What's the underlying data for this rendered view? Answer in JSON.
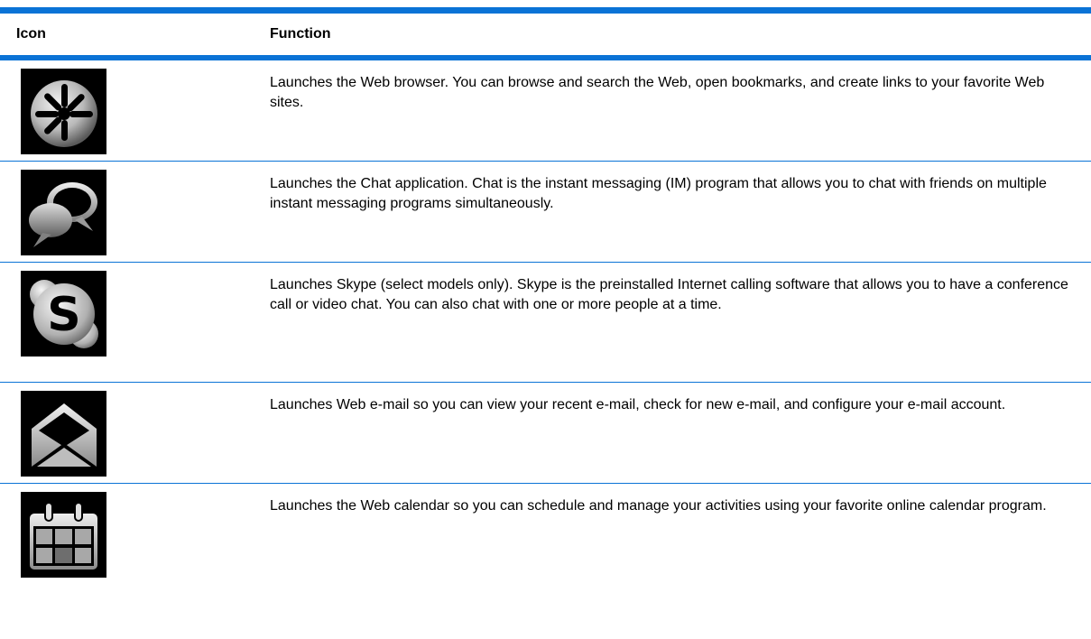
{
  "table": {
    "header": {
      "icon_label": "Icon",
      "function_label": "Function"
    },
    "rows": [
      {
        "icon": "web-browser-icon",
        "text": "Launches the Web browser. You can browse and search the Web, open bookmarks, and create links to your favorite Web sites."
      },
      {
        "icon": "chat-icon",
        "text": "Launches the Chat application. Chat is the instant messaging (IM) program that allows you to chat with friends on multiple instant messaging programs simultaneously."
      },
      {
        "icon": "skype-icon",
        "text": "Launches Skype (select models only). Skype is the preinstalled Internet calling software that allows you to have a conference call or video chat. You can also chat with one or more people at a time."
      },
      {
        "icon": "email-icon",
        "text": "Launches Web e-mail so you can view your recent e-mail, check for new e-mail, and configure your e-mail account."
      },
      {
        "icon": "calendar-icon",
        "text": "Launches the Web calendar so you can schedule and manage your activities using your favorite online calendar program."
      }
    ]
  },
  "colors": {
    "rule": "#0a73d6",
    "icon_background": "#000000"
  }
}
